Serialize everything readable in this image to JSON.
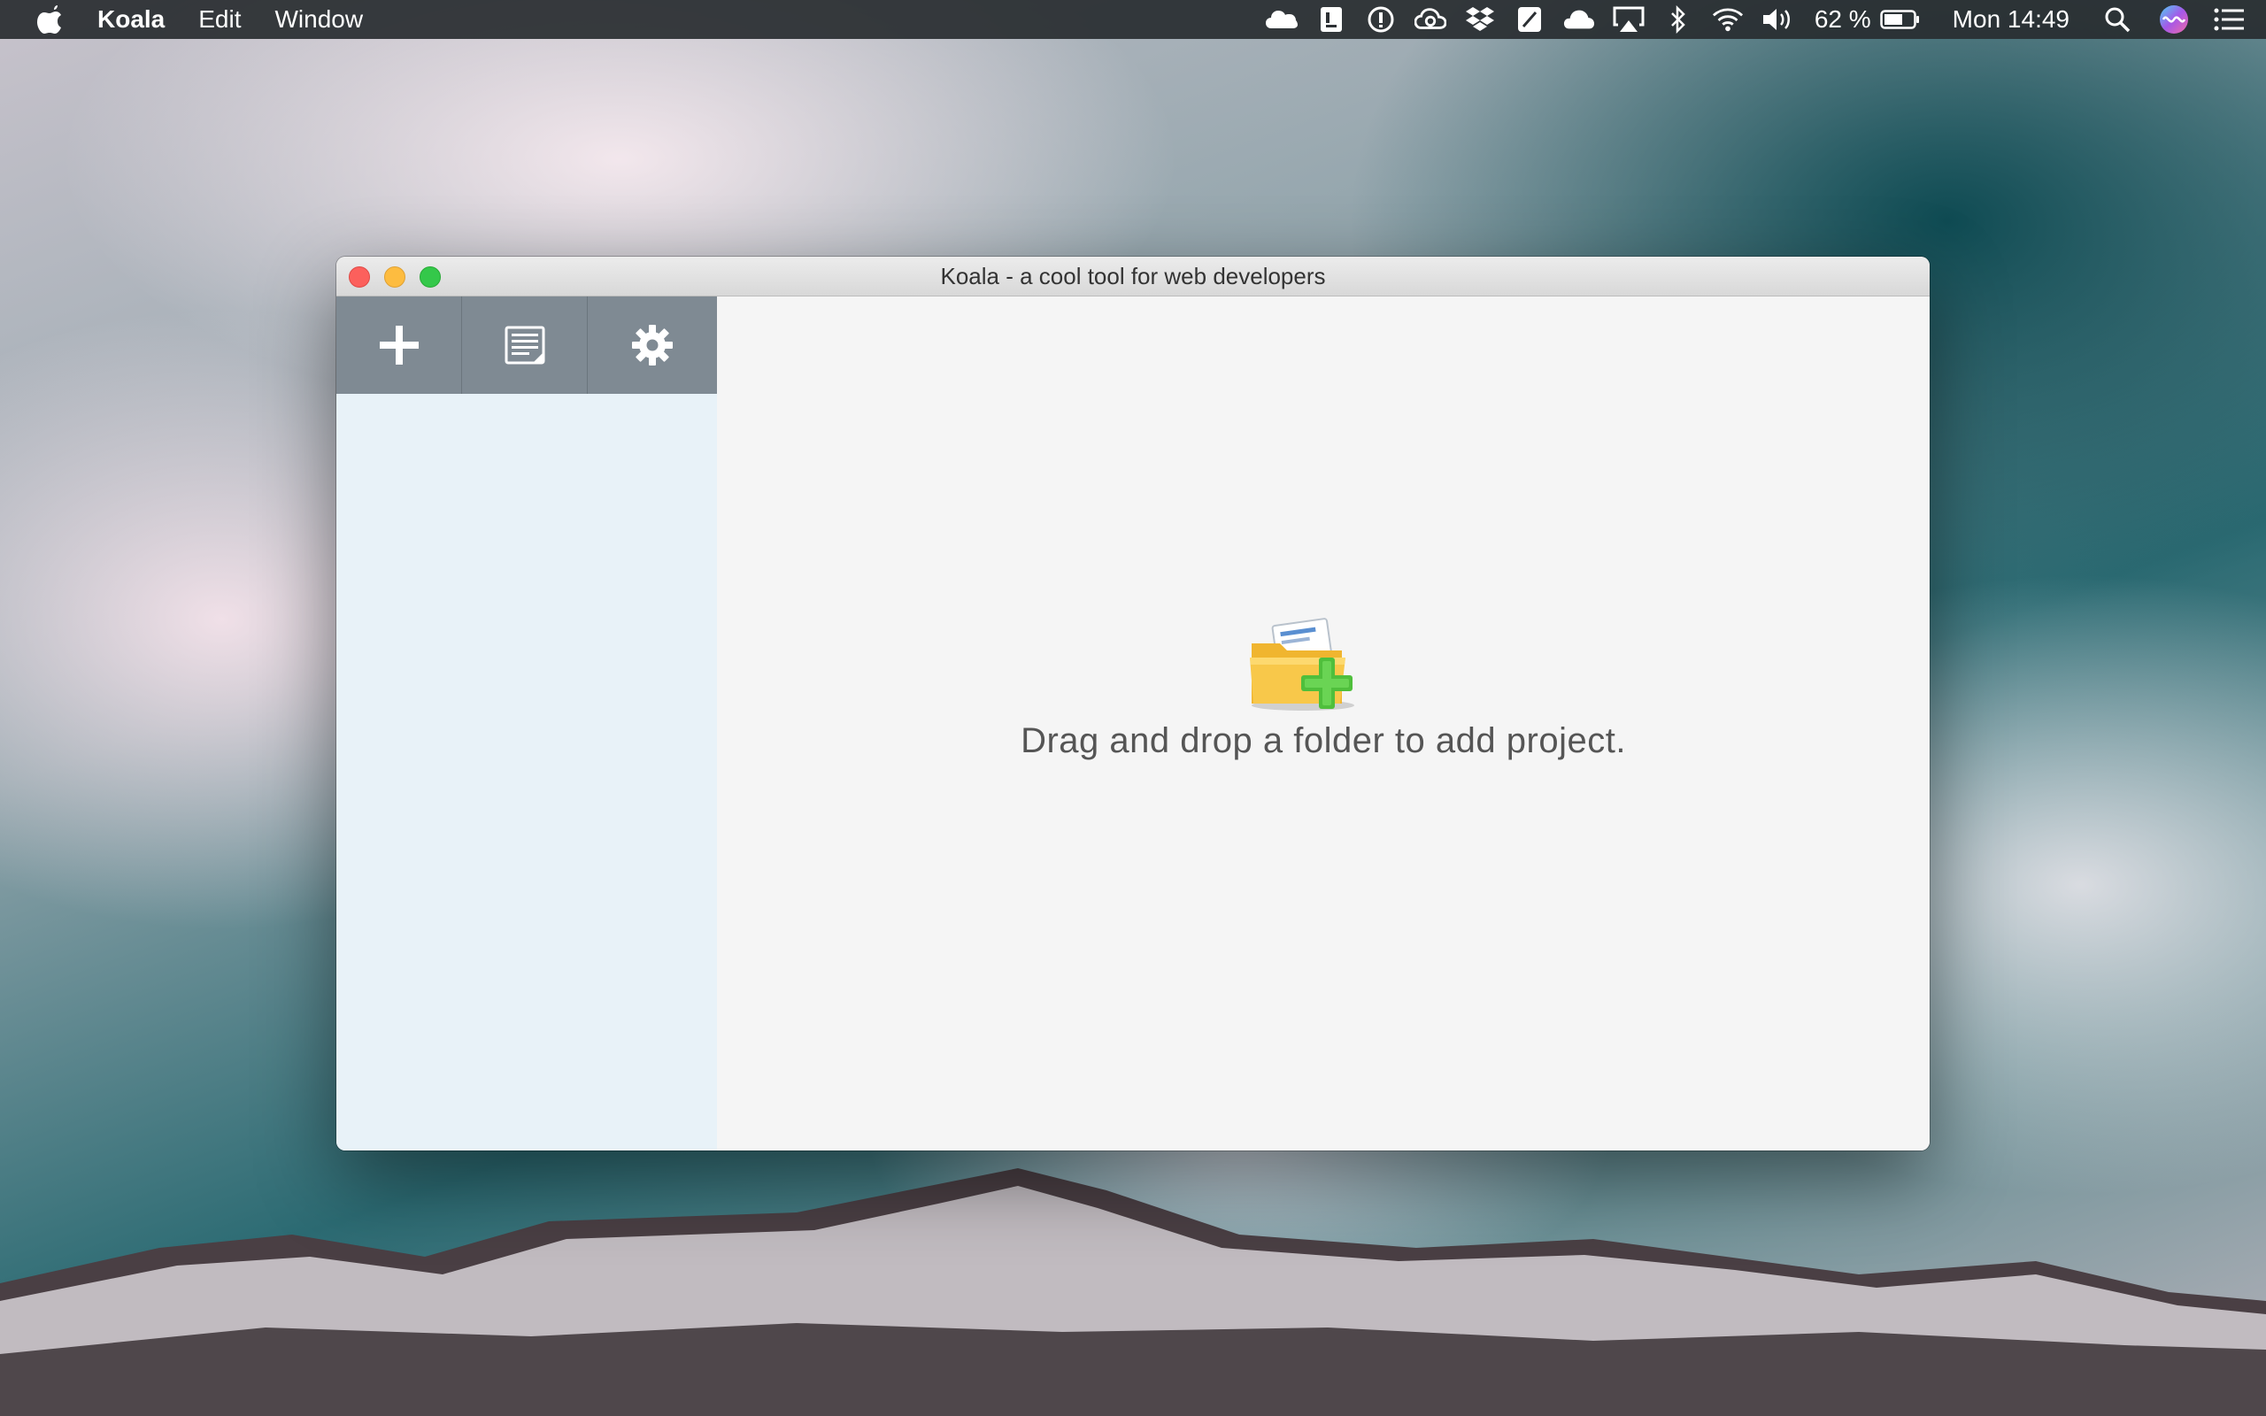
{
  "menubar": {
    "app_name": "Koala",
    "menus": [
      "Edit",
      "Window"
    ],
    "status_icons": [
      "cloud-icon",
      "script-icon",
      "info-circle-icon",
      "creative-cloud-icon",
      "dropbox-icon",
      "notes-icon",
      "cloudapp-icon",
      "airplay-icon",
      "bluetooth-icon",
      "wifi-icon",
      "volume-icon"
    ],
    "battery_percent": "62 %",
    "clock": "Mon 14:49"
  },
  "window": {
    "title": "Koala - a cool tool for web developers",
    "toolbar": {
      "add_icon": "plus-icon",
      "log_icon": "log-icon",
      "settings_icon": "gear-icon"
    },
    "main": {
      "drop_hint": "Drag and drop a folder to add project."
    }
  },
  "colors": {
    "menubar_bg": "#2c3034",
    "toolbar_bg": "#7f8a93",
    "sidebar_bg": "#e8f2f8",
    "main_bg": "#f5f5f5",
    "close": "#fc605c",
    "minimize": "#fdbc40",
    "zoom": "#34c84a"
  }
}
